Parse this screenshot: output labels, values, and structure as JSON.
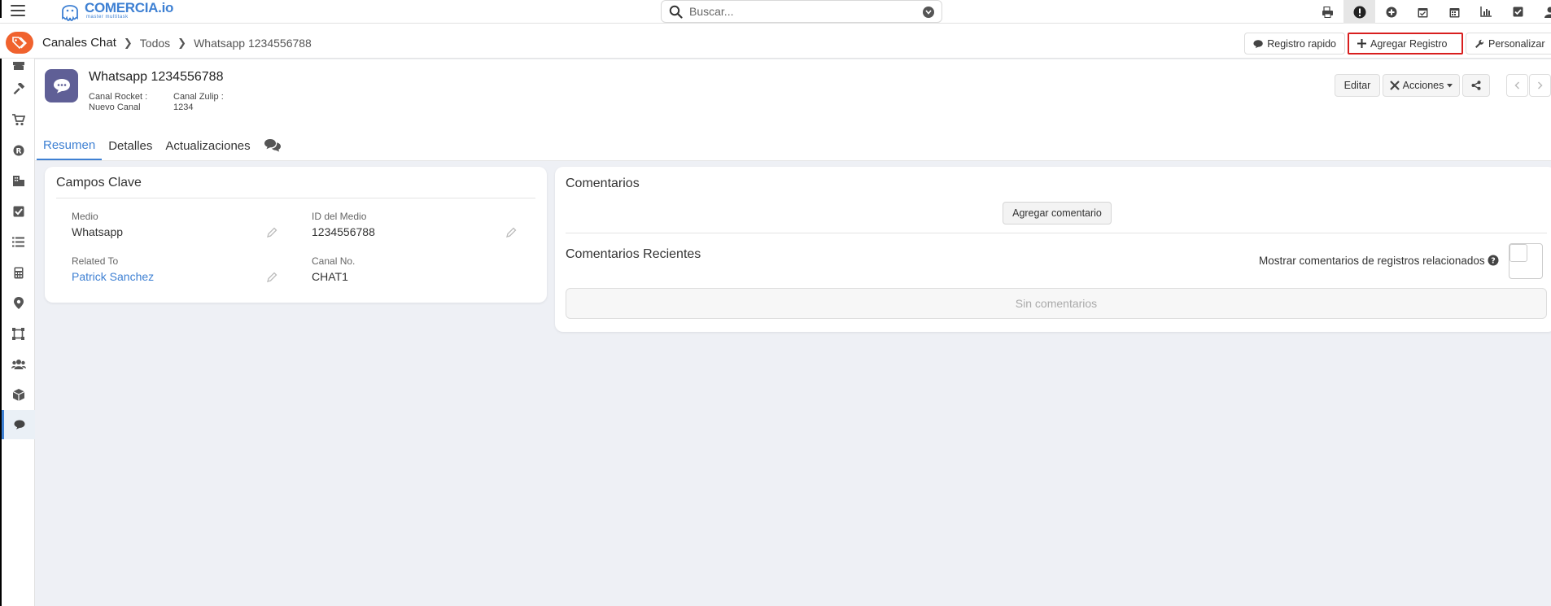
{
  "topbar": {
    "brand": "COMERCIA.io",
    "brand_tagline": "master multitask",
    "search_placeholder": "Buscar...",
    "icons": [
      "printer-icon",
      "alert-icon",
      "plus-circle-icon",
      "calendar-check-icon",
      "calendar-icon",
      "chart-icon",
      "checkbox-icon",
      "user-icon"
    ]
  },
  "breadcrumb": {
    "module": "Canales Chat",
    "list": "Todos",
    "record": "Whatsapp 1234556788"
  },
  "header_buttons": {
    "registro_rapido": "Registro rapido",
    "agregar_registro": "Agregar Registro",
    "personalizar": "Personalizar"
  },
  "record": {
    "title": "Whatsapp 1234556788",
    "summary_fields": [
      {
        "label": "Canal Rocket :",
        "value": "Nuevo Canal"
      },
      {
        "label": "Canal Zulip :",
        "value": "1234"
      }
    ],
    "buttons": {
      "editar": "Editar",
      "acciones": "Acciones"
    },
    "tabs": [
      "Resumen",
      "Detalles",
      "Actualizaciones"
    ]
  },
  "campos_clave": {
    "title": "Campos Clave",
    "fields": [
      {
        "label": "Medio",
        "value": "Whatsapp"
      },
      {
        "label": "ID del Medio",
        "value": "1234556788"
      },
      {
        "label": "Related To",
        "value": "Patrick Sanchez"
      },
      {
        "label": "Canal No.",
        "value": "CHAT1"
      }
    ]
  },
  "comentarios": {
    "title": "Comentarios",
    "add_button": "Agregar comentario",
    "recent_title": "Comentarios Recientes",
    "show_related_label": "Mostrar comentarios de registros relacionados",
    "empty_text": "Sin comentarios"
  },
  "colors": {
    "accent": "#3e80d3",
    "brand_orange": "#f0622e",
    "record_icon_bg": "#5f5f96",
    "highlight_border": "#d81e1e"
  }
}
